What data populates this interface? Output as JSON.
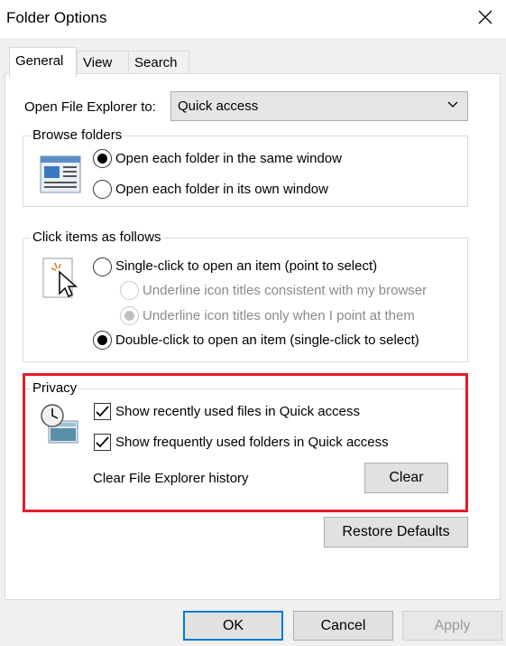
{
  "window": {
    "title": "Folder Options",
    "close_icon": "close-icon"
  },
  "tabs": [
    {
      "label": "General",
      "active": true
    },
    {
      "label": "View",
      "active": false
    },
    {
      "label": "Search",
      "active": false
    }
  ],
  "open_explorer": {
    "label": "Open File Explorer to:",
    "value": "Quick access"
  },
  "browse_folders": {
    "title": "Browse folders",
    "options": [
      {
        "label": "Open each folder in the same window",
        "checked": true
      },
      {
        "label": "Open each folder in its own window",
        "checked": false
      }
    ]
  },
  "click_items": {
    "title": "Click items as follows",
    "single_click": "Single-click to open an item (point to select)",
    "underline_browser": "Underline icon titles consistent with my browser",
    "underline_point": "Underline icon titles only when I point at them",
    "double_click": "Double-click to open an item (single-click to select)"
  },
  "privacy": {
    "title": "Privacy",
    "show_recent": "Show recently used files in Quick access",
    "show_frequent": "Show frequently used folders in Quick access",
    "clear_history_label": "Clear File Explorer history",
    "clear_button": "Clear",
    "highlight_color": "#e41d2a"
  },
  "restore_defaults": "Restore Defaults",
  "footer": {
    "ok": "OK",
    "cancel": "Cancel",
    "apply": "Apply"
  },
  "colors": {
    "accent": "#0078d7"
  }
}
